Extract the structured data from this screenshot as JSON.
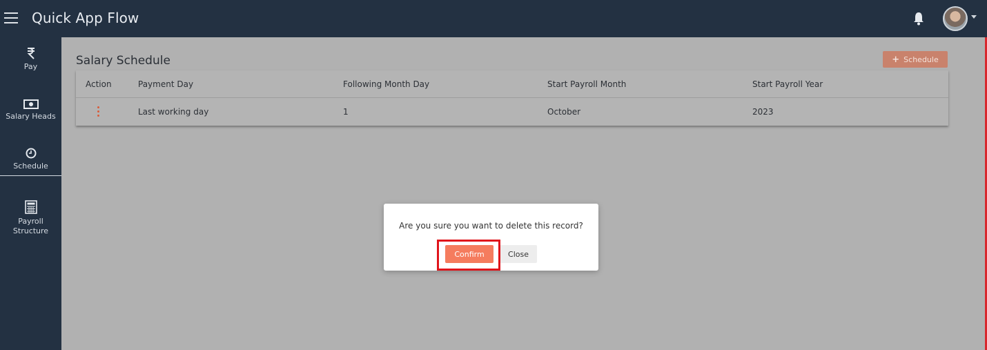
{
  "header": {
    "title": "Quick App Flow",
    "menu_icon": "hamburger-menu-icon",
    "notification_icon": "bell-icon",
    "avatar_icon": "user-avatar"
  },
  "sidebar": {
    "items": [
      {
        "label": "Pay",
        "icon": "rupee-icon"
      },
      {
        "label": "Salary Heads",
        "icon": "banknote-icon"
      },
      {
        "label": "Schedule",
        "icon": "clock-icon",
        "active": true
      },
      {
        "label": "Payroll Structure",
        "icon": "calculator-icon"
      }
    ]
  },
  "main": {
    "title": "Salary Schedule",
    "add_button_label": "Schedule",
    "table": {
      "columns": [
        "Action",
        "Payment Day",
        "Following Month Day",
        "Start Payroll Month",
        "Start Payroll Year"
      ],
      "rows": [
        [
          "",
          "Last working day",
          "1",
          "October",
          "2023"
        ]
      ]
    }
  },
  "modal": {
    "message": "Are you sure you want to delete this record?",
    "confirm_label": "Confirm",
    "close_label": "Close"
  },
  "colors": {
    "nav": "#233142",
    "accent": "#f57c5e",
    "highlight": "#e0141b"
  }
}
